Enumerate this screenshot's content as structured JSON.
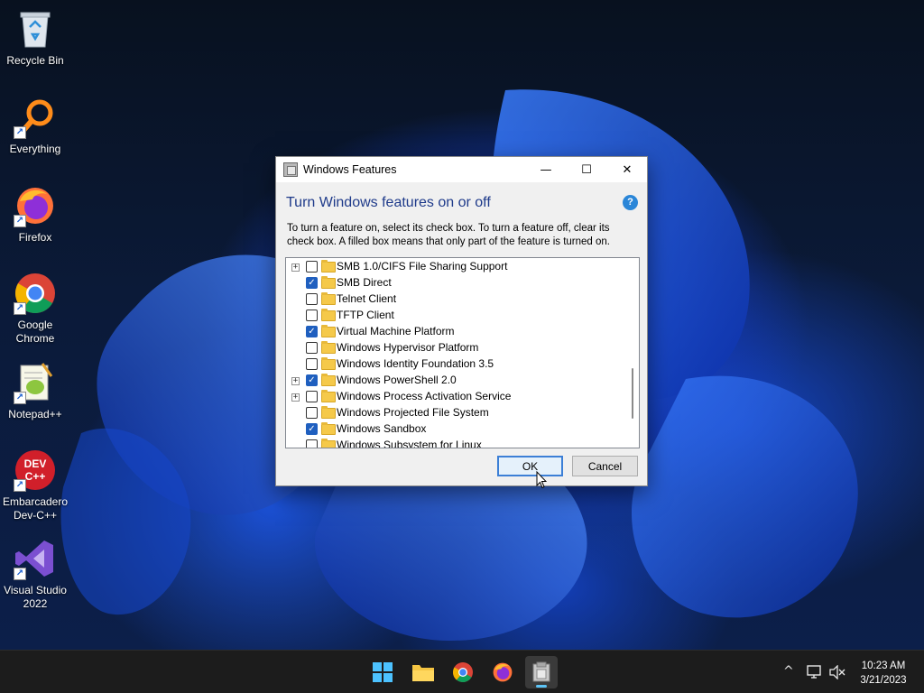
{
  "desktop": {
    "icons": [
      {
        "label": "Recycle Bin",
        "icon": "recycle-bin-icon"
      },
      {
        "label": "Everything",
        "icon": "everything-search-icon"
      },
      {
        "label": "Firefox",
        "icon": "firefox-icon"
      },
      {
        "label": "Google\nChrome",
        "icon": "chrome-icon"
      },
      {
        "label": "Notepad++",
        "icon": "notepadpp-icon"
      },
      {
        "label": "Embarcadero\nDev-C++",
        "icon": "devcpp-icon"
      },
      {
        "label": "Visual Studio\n2022",
        "icon": "visual-studio-icon"
      }
    ],
    "shortcut_glyph": "↗"
  },
  "dialog": {
    "title": "Windows Features",
    "heading": "Turn Windows features on or off",
    "help_glyph": "?",
    "description": "To turn a feature on, select its check box. To turn a feature off, clear its check box. A filled box means that only part of the feature is turned on.",
    "controls": {
      "minimize": "—",
      "maximize": "☐",
      "close": "✕"
    },
    "features": [
      {
        "label": "SMB 1.0/CIFS File Sharing Support",
        "checked": false,
        "expandable": true
      },
      {
        "label": "SMB Direct",
        "checked": true,
        "expandable": false
      },
      {
        "label": "Telnet Client",
        "checked": false,
        "expandable": false
      },
      {
        "label": "TFTP Client",
        "checked": false,
        "expandable": false
      },
      {
        "label": "Virtual Machine Platform",
        "checked": true,
        "expandable": false
      },
      {
        "label": "Windows Hypervisor Platform",
        "checked": false,
        "expandable": false
      },
      {
        "label": "Windows Identity Foundation 3.5",
        "checked": false,
        "expandable": false
      },
      {
        "label": "Windows PowerShell 2.0",
        "checked": true,
        "expandable": true
      },
      {
        "label": "Windows Process Activation Service",
        "checked": false,
        "expandable": true
      },
      {
        "label": "Windows Projected File System",
        "checked": false,
        "expandable": false
      },
      {
        "label": "Windows Sandbox",
        "checked": true,
        "expandable": false
      },
      {
        "label": "Windows Subsystem for Linux",
        "checked": false,
        "expandable": false
      }
    ],
    "ok_label": "OK",
    "cancel_label": "Cancel"
  },
  "taskbar": {
    "apps": [
      {
        "name": "start",
        "icon": "windows-start-icon"
      },
      {
        "name": "file-explorer",
        "icon": "folder-icon"
      },
      {
        "name": "chrome",
        "icon": "chrome-icon"
      },
      {
        "name": "firefox",
        "icon": "firefox-icon"
      },
      {
        "name": "windows-features",
        "icon": "windows-features-icon",
        "active": true
      }
    ],
    "tray": {
      "chevron": "^",
      "network_icon": "network-icon",
      "volume_icon": "volume-muted-icon"
    },
    "time": "10:23 AM",
    "date": "3/21/2023"
  },
  "colors": {
    "accent": "#1f5fbf",
    "heading": "#1e3a8a",
    "taskbar": "#1c1c1c",
    "folder": "#f5c94a"
  }
}
